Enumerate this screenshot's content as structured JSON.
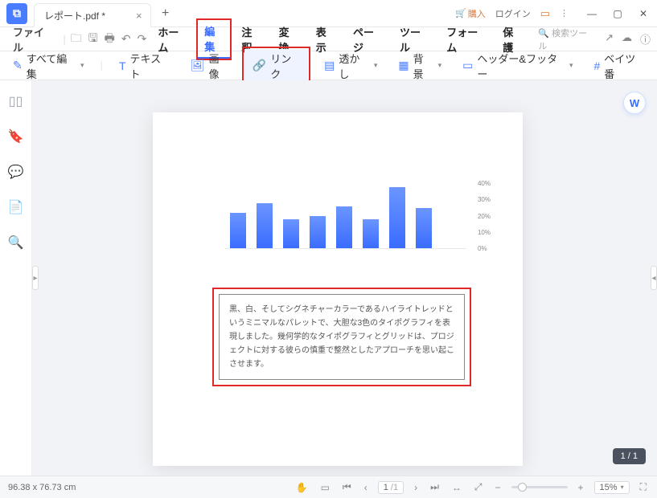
{
  "title": {
    "filename": "レポート.pdf *"
  },
  "titlebar_right": {
    "purchase": "購入",
    "login": "ログイン"
  },
  "menu": {
    "file": "ファイル",
    "home": "ホーム",
    "edit": "編集",
    "comment": "注釈",
    "convert": "変換",
    "view": "表示",
    "page": "ページ",
    "tool": "ツール",
    "form": "フォーム",
    "protect": "保護",
    "search_placeholder": "検索ツール"
  },
  "toolbar": {
    "edit_all": "すべて編集",
    "text": "テキスト",
    "image": "画像",
    "link": "リンク",
    "watermark": "透かし",
    "background": "背景",
    "header_footer": "ヘッダー&フッター",
    "bates": "ベイツ番"
  },
  "chart_data": {
    "type": "bar",
    "values": [
      22,
      28,
      18,
      20,
      26,
      18,
      38,
      25
    ],
    "ylim": [
      0,
      40
    ],
    "yticks": [
      "40%",
      "30%",
      "20%",
      "10%",
      "0%"
    ]
  },
  "textblock": {
    "content": "黒、白、そしてシグネチャーカラーであるハイライトレッドというミニマルなパレットで、大胆な3色のタイポグラフィを表現しました。幾何学的なタイポグラフィとグリッドは、プロジェクトに対する彼らの慎重で整然としたアプローチを思い起こさせます。"
  },
  "pagecounter": {
    "text": "1 / 1"
  },
  "statusbar": {
    "dimensions": "96.38 x 76.73 cm",
    "page_current": "1",
    "page_total": "/1",
    "zoom": "15%"
  }
}
